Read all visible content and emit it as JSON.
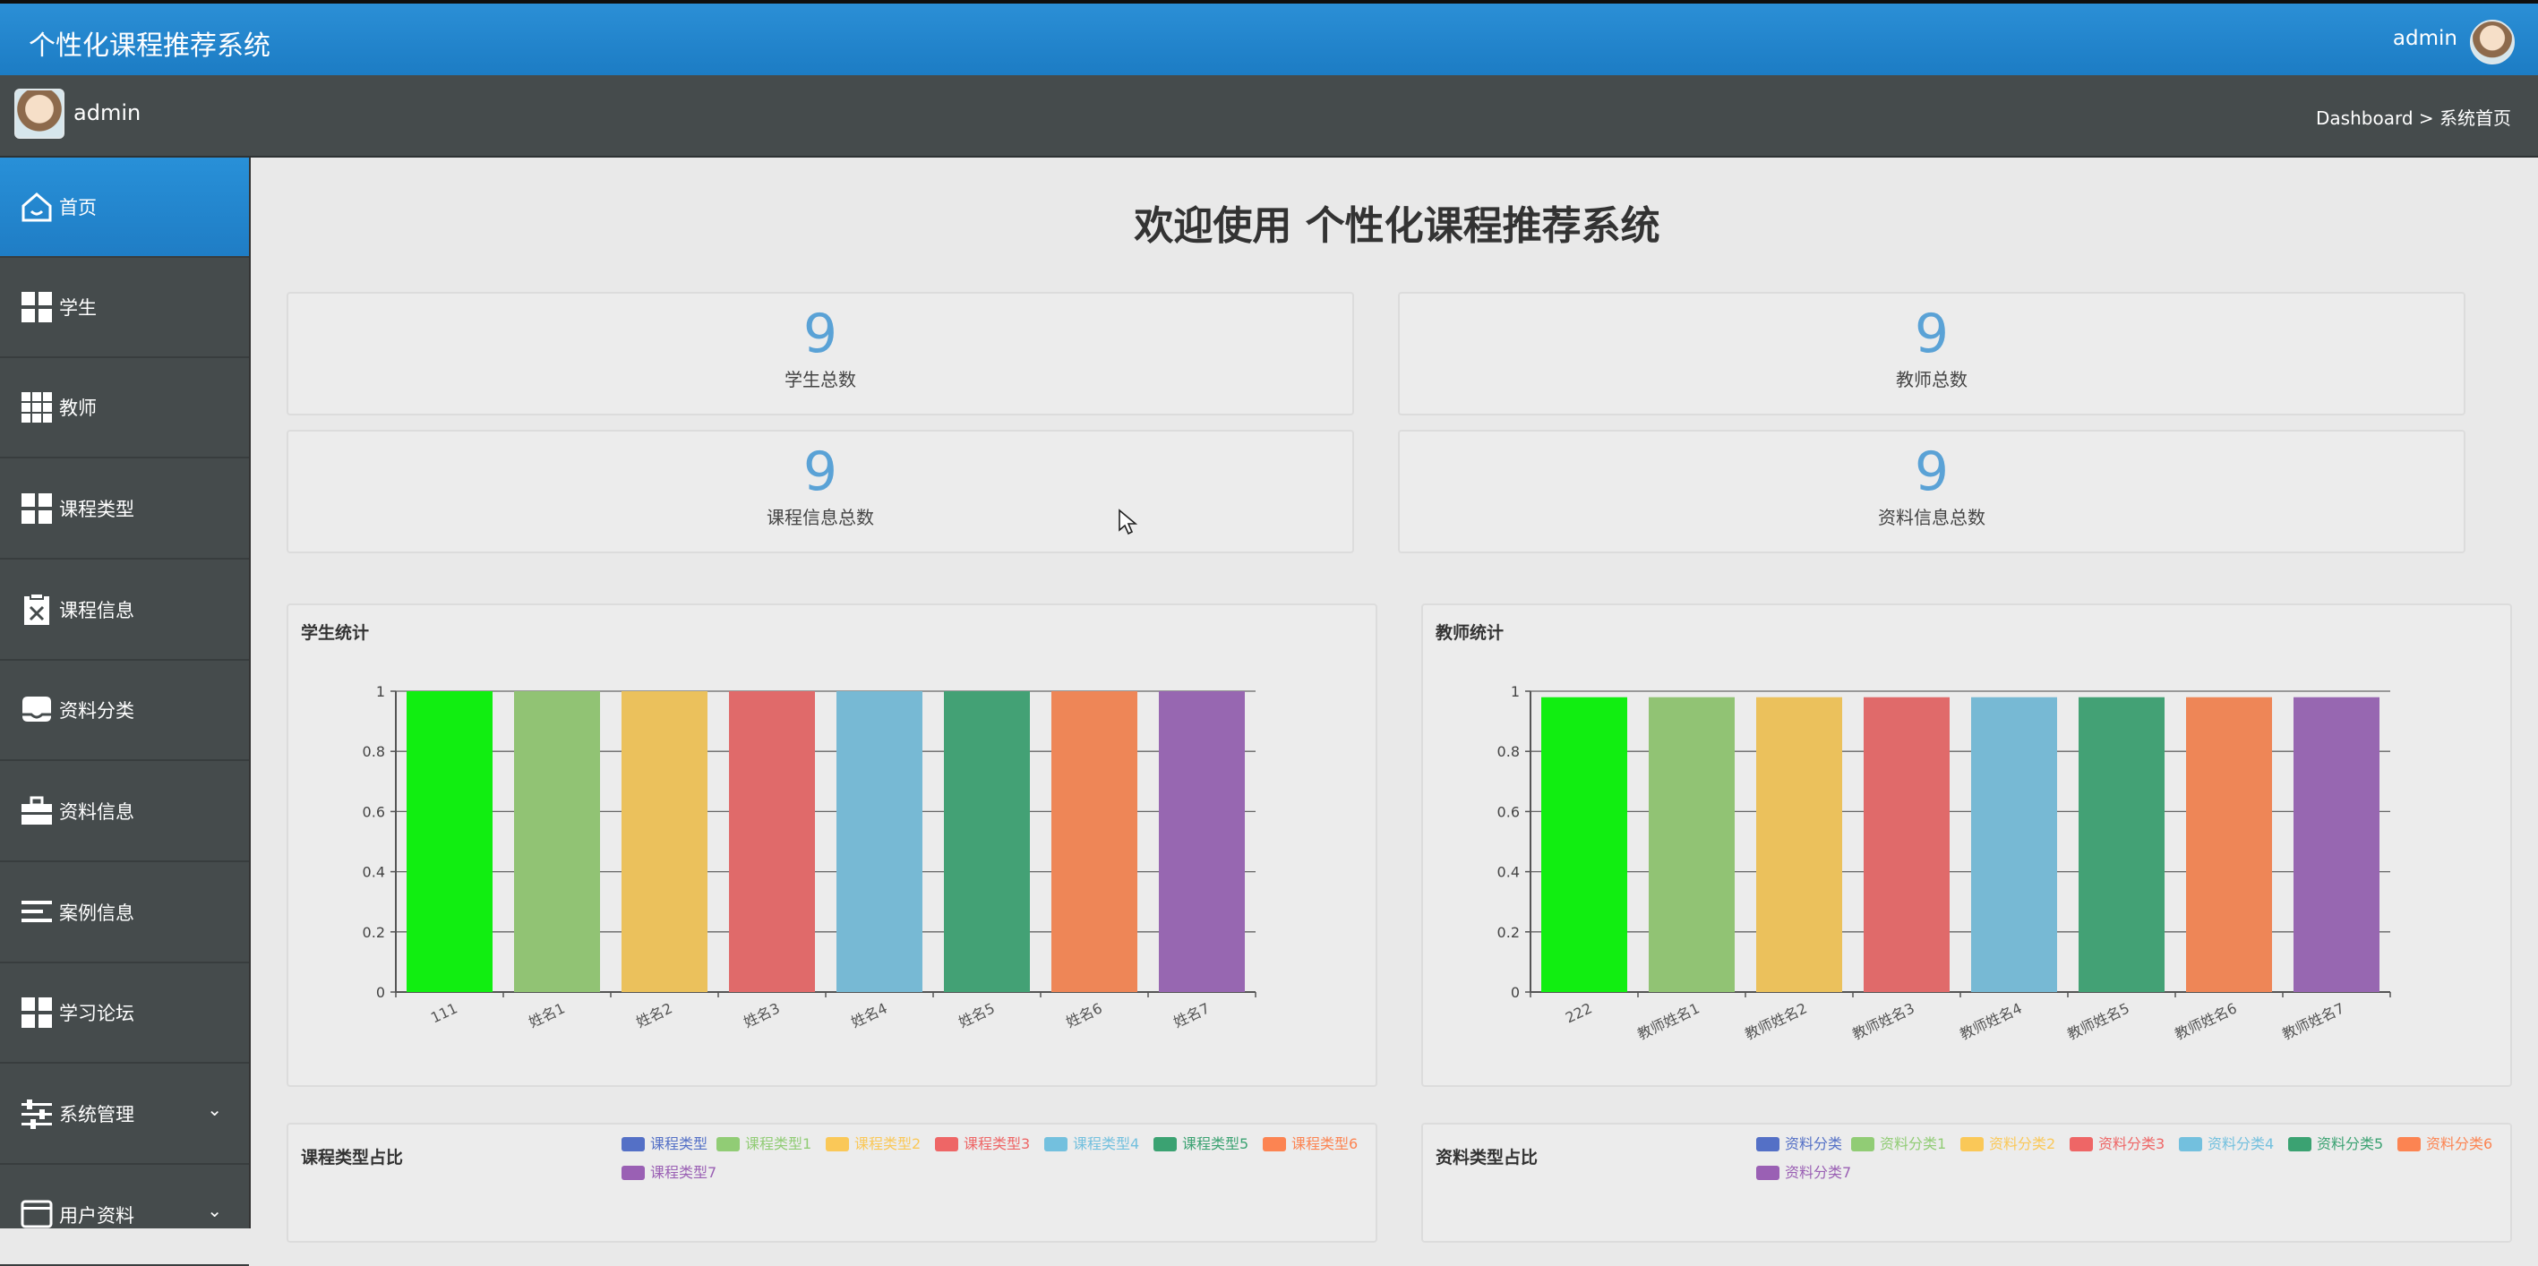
{
  "app": {
    "title": "个性化课程推荐系统",
    "user": "admin"
  },
  "subbar": {
    "username": "admin",
    "breadcrumb": "Dashboard > 系统首页"
  },
  "sidebar": {
    "items": [
      {
        "label": "首页",
        "icon": "home-icon",
        "active": true
      },
      {
        "label": "学生",
        "icon": "grid-icon"
      },
      {
        "label": "教师",
        "icon": "grid9-icon"
      },
      {
        "label": "课程类型",
        "icon": "grid-icon"
      },
      {
        "label": "课程信息",
        "icon": "clipboard-x-icon"
      },
      {
        "label": "资料分类",
        "icon": "tray-icon"
      },
      {
        "label": "资料信息",
        "icon": "briefcase-icon"
      },
      {
        "label": "案例信息",
        "icon": "list-icon"
      },
      {
        "label": "学习论坛",
        "icon": "grid-icon"
      },
      {
        "label": "系统管理",
        "icon": "sliders-icon",
        "expandable": true
      },
      {
        "label": "用户资料",
        "icon": "user-card-icon",
        "expandable": true
      }
    ]
  },
  "main": {
    "welcome": "欢迎使用 个性化课程推荐系统",
    "stats": [
      {
        "value": "9",
        "label": "学生总数"
      },
      {
        "value": "9",
        "label": "教师总数"
      },
      {
        "value": "9",
        "label": "课程信息总数"
      },
      {
        "value": "9",
        "label": "资料信息总数"
      }
    ],
    "panels": {
      "student_title": "学生统计",
      "teacher_title": "教师统计",
      "course_type_title": "课程类型占比",
      "material_type_title": "资料类型占比"
    }
  },
  "colors": [
    "#11ee11",
    "#91c374",
    "#ebc15c",
    "#e06a6a",
    "#77b9d4",
    "#43a175",
    "#ee8657",
    "#9767b1"
  ],
  "legend_colors": [
    "#5470c6",
    "#91cc75",
    "#fac858",
    "#ee6666",
    "#73c0de",
    "#3ba272",
    "#fc8452",
    "#9a60b4"
  ],
  "chart_data": [
    {
      "type": "bar",
      "title": "学生统计",
      "categories": [
        "111",
        "姓名1",
        "姓名2",
        "姓名3",
        "姓名4",
        "姓名5",
        "姓名6",
        "姓名7"
      ],
      "values": [
        1,
        1,
        1,
        1,
        1,
        1,
        1,
        1
      ],
      "ylim": [
        0,
        1
      ],
      "yticks": [
        "0",
        "0.2",
        "0.4",
        "0.6",
        "0.8",
        "1"
      ],
      "grid": true
    },
    {
      "type": "bar",
      "title": "教师统计",
      "categories": [
        "222",
        "教师姓名1",
        "教师姓名2",
        "教师姓名3",
        "教师姓名4",
        "教师姓名5",
        "教师姓名6",
        "教师姓名7"
      ],
      "values": [
        0.98,
        0.98,
        0.98,
        0.98,
        0.98,
        0.98,
        0.98,
        0.98
      ],
      "ylim": [
        0,
        1
      ],
      "yticks": [
        "0",
        "0.2",
        "0.4",
        "0.6",
        "0.8",
        "1"
      ],
      "grid": true
    },
    {
      "type": "pie",
      "title": "课程类型占比",
      "legend": [
        "课程类型",
        "课程类型1",
        "课程类型2",
        "课程类型3",
        "课程类型4",
        "课程类型5",
        "课程类型6",
        "课程类型7"
      ]
    },
    {
      "type": "pie",
      "title": "资料类型占比",
      "legend": [
        "资料分类",
        "资料分类1",
        "资料分类2",
        "资料分类3",
        "资料分类4",
        "资料分类5",
        "资料分类6",
        "资料分类7"
      ]
    }
  ]
}
